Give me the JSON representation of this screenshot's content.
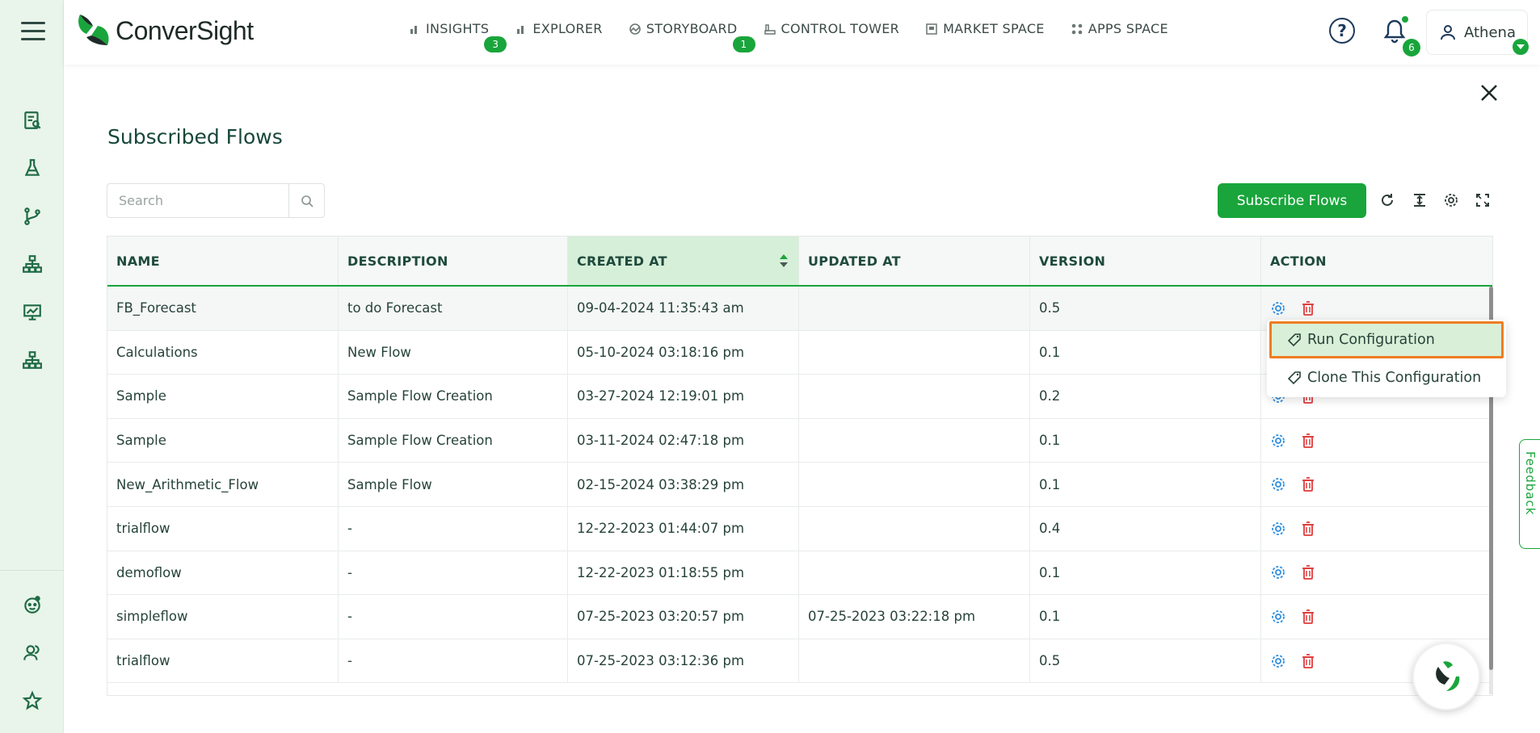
{
  "app": {
    "name": "ConverSight",
    "brand_color": "#19a53b"
  },
  "nav": [
    {
      "label": "INSIGHTS",
      "badge": "3"
    },
    {
      "label": "EXPLORER",
      "badge": ""
    },
    {
      "label": "STORYBOARD",
      "badge": "1"
    },
    {
      "label": "CONTROL TOWER",
      "badge": ""
    },
    {
      "label": "MARKET SPACE",
      "badge": ""
    },
    {
      "label": "APPS SPACE",
      "badge": ""
    }
  ],
  "header": {
    "help": "?",
    "notifications_count": "6",
    "user_name": "Athena"
  },
  "page": {
    "title": "Subscribed Flows",
    "search_placeholder": "Search",
    "subscribe_label": "Subscribe Flows"
  },
  "table": {
    "columns": [
      "NAME",
      "DESCRIPTION",
      "CREATED AT",
      "UPDATED AT",
      "VERSION",
      "ACTION"
    ],
    "rows": [
      {
        "name": "FB_Forecast",
        "description": "to do Forecast",
        "created": "09-04-2024 11:35:43 am",
        "updated": "",
        "version": "0.5"
      },
      {
        "name": "Calculations",
        "description": "New Flow",
        "created": "05-10-2024 03:18:16 pm",
        "updated": "",
        "version": "0.1"
      },
      {
        "name": "Sample",
        "description": "Sample Flow Creation",
        "created": "03-27-2024 12:19:01 pm",
        "updated": "",
        "version": "0.2"
      },
      {
        "name": "Sample",
        "description": "Sample Flow Creation",
        "created": "03-11-2024 02:47:18 pm",
        "updated": "",
        "version": "0.1"
      },
      {
        "name": "New_Arithmetic_Flow",
        "description": "Sample Flow",
        "created": "02-15-2024 03:38:29 pm",
        "updated": "",
        "version": "0.1"
      },
      {
        "name": "trialflow",
        "description": "-",
        "created": "12-22-2023 01:44:07 pm",
        "updated": "",
        "version": "0.4"
      },
      {
        "name": "demoflow",
        "description": "-",
        "created": "12-22-2023 01:18:55 pm",
        "updated": "",
        "version": "0.1"
      },
      {
        "name": "simpleflow",
        "description": "-",
        "created": "07-25-2023 03:20:57 pm",
        "updated": "07-25-2023 03:22:18 pm",
        "version": "0.1"
      },
      {
        "name": "trialflow",
        "description": "-",
        "created": "07-25-2023 03:12:36 pm",
        "updated": "",
        "version": "0.5"
      }
    ]
  },
  "context_menu": {
    "items": [
      "Run Configuration",
      "Clone This Configuration"
    ]
  },
  "feedback": {
    "label": "Feedback"
  }
}
